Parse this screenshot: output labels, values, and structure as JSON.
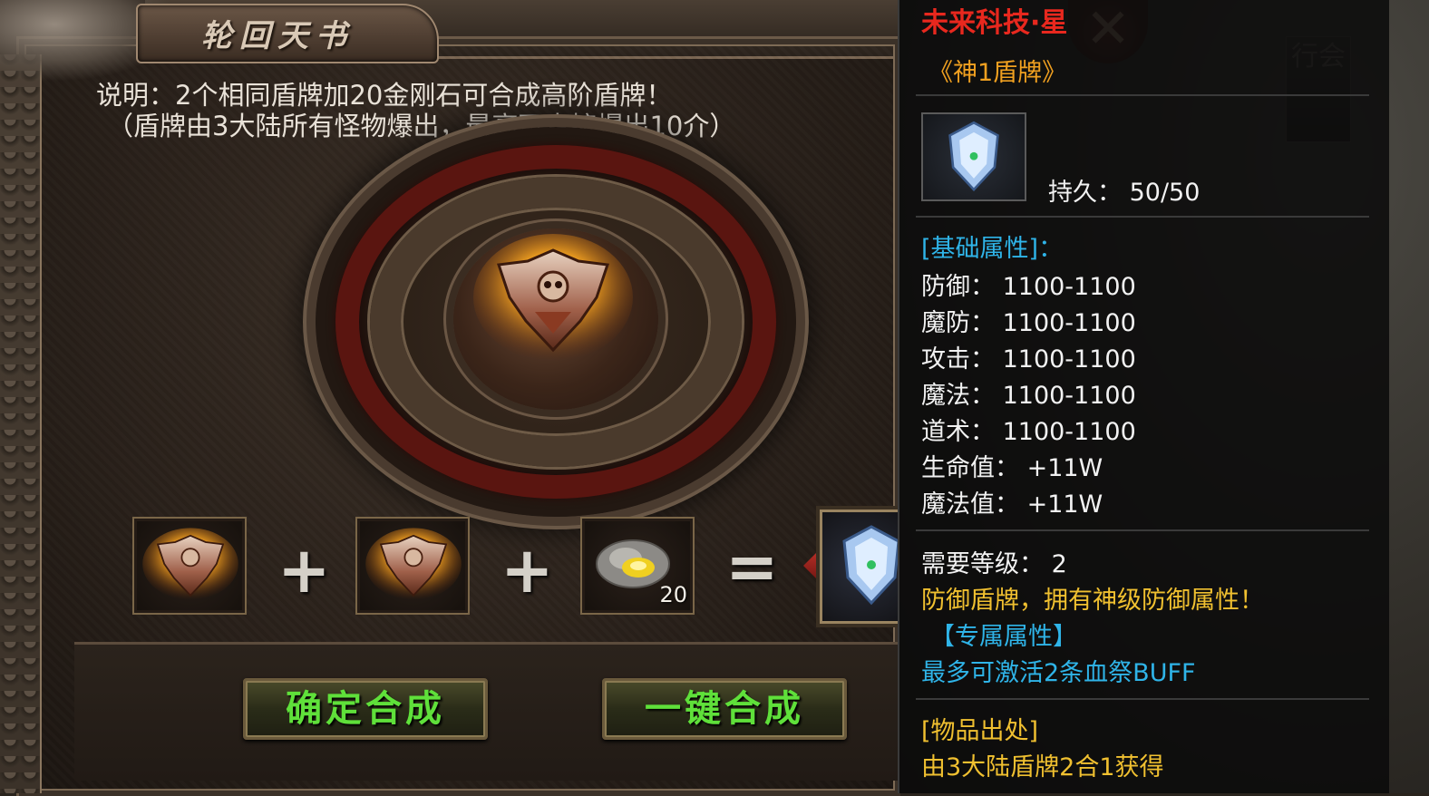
{
  "window": {
    "title": "轮回天书",
    "description_line1": "说明：2个相同盾牌加20金刚石可合成高阶盾牌！",
    "description_line2": "（盾牌由3大陆所有怪物爆出，最高可直接爆出10介）"
  },
  "recipe": {
    "plus1": "+",
    "plus2": "+",
    "equals": "=",
    "material_count": "20"
  },
  "buttons": {
    "confirm": "确定合成",
    "one_click": "一键合成"
  },
  "world": {
    "side_button": "行会"
  },
  "tooltip": {
    "name_header": "未来科技·星",
    "item_name": "《神1盾牌》",
    "durability": "持久：  50/50",
    "base_attr_header": "[基础属性]：",
    "stats": [
      "防御：  1100-1100",
      "魔防：  1100-1100",
      "攻击：  1100-1100",
      "魔法：  1100-1100",
      "道术：  1100-1100",
      "生命值：  +11W",
      "魔法值：  +11W"
    ],
    "required_level": "需要等级：  2",
    "desc": "防御盾牌，拥有神级防御属性！",
    "exclusive_header": "【专属属性】",
    "exclusive_desc": "最多可激活2条血祭BUFF",
    "source_header": "[物品出处]",
    "source_desc": "由3大陆盾牌2合1获得"
  },
  "colors": {
    "name_red": "#e8281e",
    "item_orange": "#f0a020",
    "cyan": "#2fb4e8",
    "green_button_text": "#5fe03a",
    "stat_white": "#f2f2f2",
    "desc_yellow": "#f0c030"
  }
}
